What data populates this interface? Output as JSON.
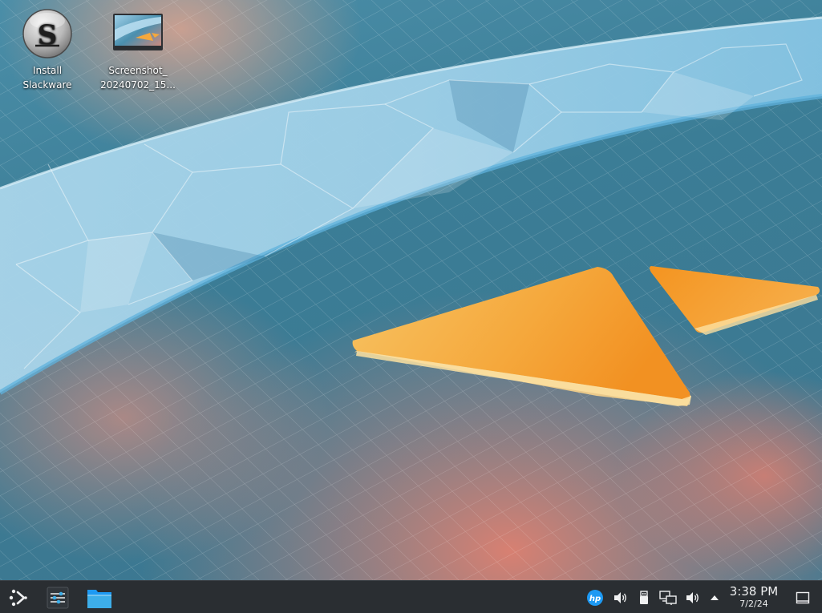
{
  "desktop": {
    "icons": [
      {
        "label_line1": "Install",
        "label_line2": "Slackware",
        "icon": "slackware-icon"
      },
      {
        "label_line1": "Screenshot_",
        "label_line2": "20240702_15...",
        "icon": "image-thumbnail-icon"
      }
    ],
    "wallpaper": "kde-plasma-default-wallpaper"
  },
  "taskbar": {
    "launcher_icon": "application-launcher-icon",
    "pinned": [
      {
        "icon": "system-settings-icon"
      },
      {
        "icon": "file-manager-folder-icon"
      }
    ],
    "tray": [
      {
        "icon": "hp-printer-icon"
      },
      {
        "icon": "volume-icon"
      },
      {
        "icon": "usb-device-icon"
      },
      {
        "icon": "network-icon"
      },
      {
        "icon": "volume-icon"
      },
      {
        "icon": "show-hidden-icons-arrow"
      }
    ],
    "clock": {
      "time": "3:38 PM",
      "date": "7/2/24"
    },
    "show_desktop_icon": "show-desktop-icon"
  },
  "colors": {
    "taskbar_bg": "#2a2e32",
    "accent_orange": "#f59a2a",
    "accent_blue": "#3daee9"
  }
}
